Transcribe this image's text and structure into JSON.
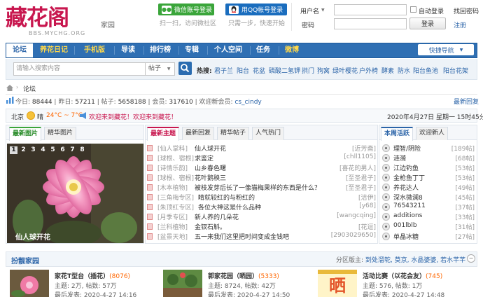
{
  "logo": {
    "text": "藏花阁",
    "site": "BBS.MYCHG.ORG",
    "sub": "家园"
  },
  "social": {
    "wechat_login": "微信账号登录",
    "wechat_tip": "扫一扫，访问微社区",
    "qq_login": "用QQ帐号登录",
    "qq_tip": "只需一步，快速开始"
  },
  "login": {
    "user_label": "用户名",
    "password_label": "密码",
    "auto_login": "自动登录",
    "login_button": "登录",
    "find_password": "找回密码",
    "register": "注册"
  },
  "nav": {
    "items": [
      "论坛",
      "养花日记",
      "手机版",
      "导读",
      "排行榜",
      "专辑",
      "个人空间",
      "任务",
      "微博"
    ],
    "quick_nav": "快捷导航"
  },
  "search": {
    "placeholder": "请输入搜索内容",
    "type": "帖子",
    "hot_label": "热搜:",
    "hot_words": [
      "君子兰",
      "阳台",
      "花盆",
      "磷酸二氢钾",
      "拱门",
      "狗窝",
      "绿叶樱花",
      "户外椅",
      "酵素",
      "防水",
      "阳台鱼池",
      "阳台花架"
    ]
  },
  "breadcrumb": {
    "label": "论坛"
  },
  "stats": {
    "today_label": "今日:",
    "today": "88444",
    "yesterday_label": "昨日:",
    "yesterday": "57211",
    "posts_label": "帖子:",
    "posts": "5658188",
    "members_label": "会员:",
    "members": "317610",
    "newest_label": "欢迎新会员:",
    "newest": "cs_cindy",
    "latest_link": "最新回复"
  },
  "weather": {
    "city": "北京",
    "desc": "晴",
    "temp": "24°C ~ 7°C",
    "welcome": "欢迎来到藏花！欢迎来到藏花！",
    "date": "2020年4月27日 星期一 15时45分"
  },
  "left_tabs": [
    "最新图片",
    "精华图片"
  ],
  "slideshow": {
    "numbers": [
      "1",
      "2",
      "3",
      "4",
      "5",
      "6",
      "7",
      "8"
    ],
    "caption": "仙人球开花"
  },
  "mid_tabs": [
    "最新主题",
    "最新回复",
    "精华帖子",
    "人气热门"
  ],
  "threads": [
    {
      "cat": "[仙人掌科]",
      "title": "仙人球开花",
      "author": "[近芳斋]"
    },
    {
      "cat": "[球根、宿根]",
      "title": "求鉴定",
      "author": "[chll1105]"
    },
    {
      "cat": "[诗情乐韵]",
      "title": "山乡春色曙",
      "author": "[喜花的男人]"
    },
    {
      "cat": "[球根、宿根]",
      "title": "花叶鹅秧三",
      "author": "[至圣君子]"
    },
    {
      "cat": "[木本植物]",
      "title": "被枝发芽后长了一像猫梅果样的东西是什么？",
      "author": "[至圣君子]"
    },
    {
      "cat": "[三角梅专区]",
      "title": "睛就较红的与粉红的",
      "author": "[洁伊]"
    },
    {
      "cat": "[朱顶红专区]",
      "title": "各位大神这是什么品种",
      "author": "[y68]"
    },
    {
      "cat": "[月季专区]",
      "title": "新人养的几朵花",
      "author": "[wangcqing]"
    },
    {
      "cat": "[兰科植物]",
      "title": "金钗石斛。",
      "author": "[花逗]"
    },
    {
      "cat": "[盆景天地]",
      "title": "五一来我们这里把时间变成金钱吧",
      "author": "[2903029650]"
    }
  ],
  "right_tabs": [
    "本周活跃",
    "欢迎新人"
  ],
  "ranking": [
    {
      "name": "理智/阴险",
      "score": "[189帖]"
    },
    {
      "name": "涟漪",
      "score": "[68帖]"
    },
    {
      "name": "江边钓鱼",
      "score": "[53帖]"
    },
    {
      "name": "金枪鱼丁丁",
      "score": "[53帖]"
    },
    {
      "name": "养花达人",
      "score": "[49帖]"
    },
    {
      "name": "深水微澜8",
      "score": "[45帖]"
    },
    {
      "name": "76543211",
      "score": "[37帖]"
    },
    {
      "name": "additions",
      "score": "[33帖]"
    },
    {
      "name": "001lblb",
      "score": "[31帖]"
    },
    {
      "name": "单晶冰糖",
      "score": "[27帖]"
    }
  ],
  "section": {
    "name": "扮靓家园",
    "mods_label": "分区版主:",
    "mods": "到处溜鸵, 莫京, 水晶婆婆, 若水芊芊",
    "toggle": "−"
  },
  "forums": [
    {
      "name": "家花T型台（插花）",
      "count": "(8076)",
      "stats": "主题: 2万, 帖数: 57万",
      "last": "最后发表: 2020-4-27 14:16"
    },
    {
      "name": "郭家花园（晒园）",
      "count": "(5333)",
      "stats": "主题: 8724, 帖数: 42万",
      "last": "最后发表: 2020-4-27 14:50"
    },
    {
      "name": "活动比赛（以花会友）",
      "count": "(745)",
      "stats": "主题: 576, 帖数: 1万",
      "last": "最后发表: 2020-4-27 14:48"
    }
  ],
  "colors": {
    "brand": "#c8174f",
    "nav": "#2f6fb3",
    "link": "#2b64a8",
    "accent": "#ff6600"
  }
}
